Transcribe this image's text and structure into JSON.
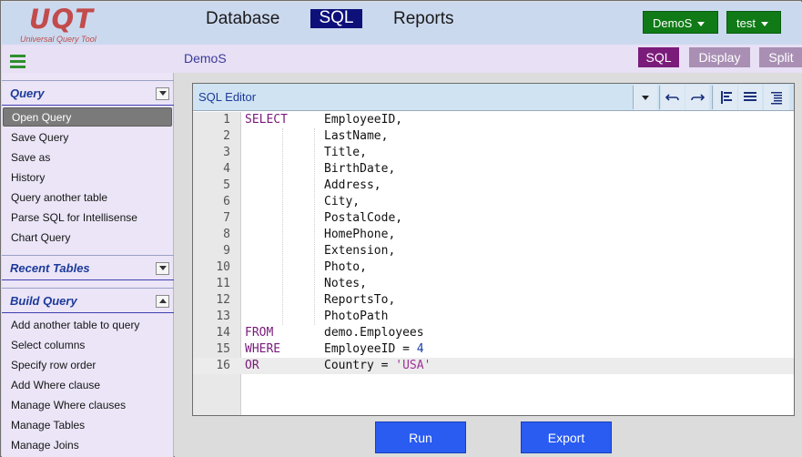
{
  "app": {
    "logo_text": "UQT",
    "logo_subtitle": "Universal Query Tool"
  },
  "topnav": {
    "items": [
      {
        "label": "Database",
        "active": false
      },
      {
        "label": "SQL",
        "active": true
      },
      {
        "label": "Reports",
        "active": false
      }
    ],
    "database_button": "DemoS",
    "user_button": "test"
  },
  "subbar": {
    "title": "DemoS",
    "views": [
      "SQL",
      "Display",
      "Split"
    ],
    "active_view": "SQL"
  },
  "sidebar": {
    "query_header": "Query",
    "query_items": [
      {
        "label": "Open Query",
        "active": true
      },
      {
        "label": "Save Query"
      },
      {
        "label": "Save as"
      },
      {
        "label": "History"
      },
      {
        "label": "Query another table"
      },
      {
        "label": "Parse SQL for Intellisense"
      },
      {
        "label": "Chart Query"
      }
    ],
    "recent_header": "Recent Tables",
    "build_header": "Build Query",
    "build_items": [
      {
        "label": "Add another table to query"
      },
      {
        "label": "Select columns"
      },
      {
        "label": "Specify row order"
      },
      {
        "label": "Add Where clause"
      },
      {
        "label": "Manage Where clauses"
      },
      {
        "label": "Manage Tables"
      },
      {
        "label": "Manage Joins"
      }
    ]
  },
  "editor": {
    "title": "SQL Editor",
    "lines": [
      {
        "n": "1",
        "kw": "SELECT",
        "code": "EmployeeID,"
      },
      {
        "n": "2",
        "kw": "",
        "code": "LastName,"
      },
      {
        "n": "3",
        "kw": "",
        "code": "Title,"
      },
      {
        "n": "4",
        "kw": "",
        "code": "BirthDate,"
      },
      {
        "n": "5",
        "kw": "",
        "code": "Address,"
      },
      {
        "n": "6",
        "kw": "",
        "code": "City,"
      },
      {
        "n": "7",
        "kw": "",
        "code": "PostalCode,"
      },
      {
        "n": "8",
        "kw": "",
        "code": "HomePhone,"
      },
      {
        "n": "9",
        "kw": "",
        "code": "Extension,"
      },
      {
        "n": "10",
        "kw": "",
        "code": "Photo,"
      },
      {
        "n": "11",
        "kw": "",
        "code": "Notes,"
      },
      {
        "n": "12",
        "kw": "",
        "code": "ReportsTo,"
      },
      {
        "n": "13",
        "kw": "",
        "code": "PhotoPath"
      },
      {
        "n": "14",
        "kw": "FROM",
        "code": "demo.Employees"
      },
      {
        "n": "15",
        "kw": "WHERE",
        "code": "EmployeeID = ",
        "num": "4"
      },
      {
        "n": "16",
        "kw": "OR",
        "code": "Country = ",
        "str": "'USA'"
      }
    ],
    "toolbar_icons": [
      "dropdown-icon",
      "undo-icon",
      "redo-icon",
      "align-left-icon",
      "align-justify-icon",
      "indent-icon"
    ]
  },
  "actions": {
    "run_label": "Run",
    "export_label": "Export"
  },
  "colors": {
    "header_bg": "#cbd9ef",
    "nav_active": "#0e107a",
    "green_button": "#0f7a16",
    "view_active": "#7a1c7a",
    "view_inactive": "#a98fb4",
    "keyword": "#7a1a7a",
    "action_button": "#2a5cf2"
  }
}
